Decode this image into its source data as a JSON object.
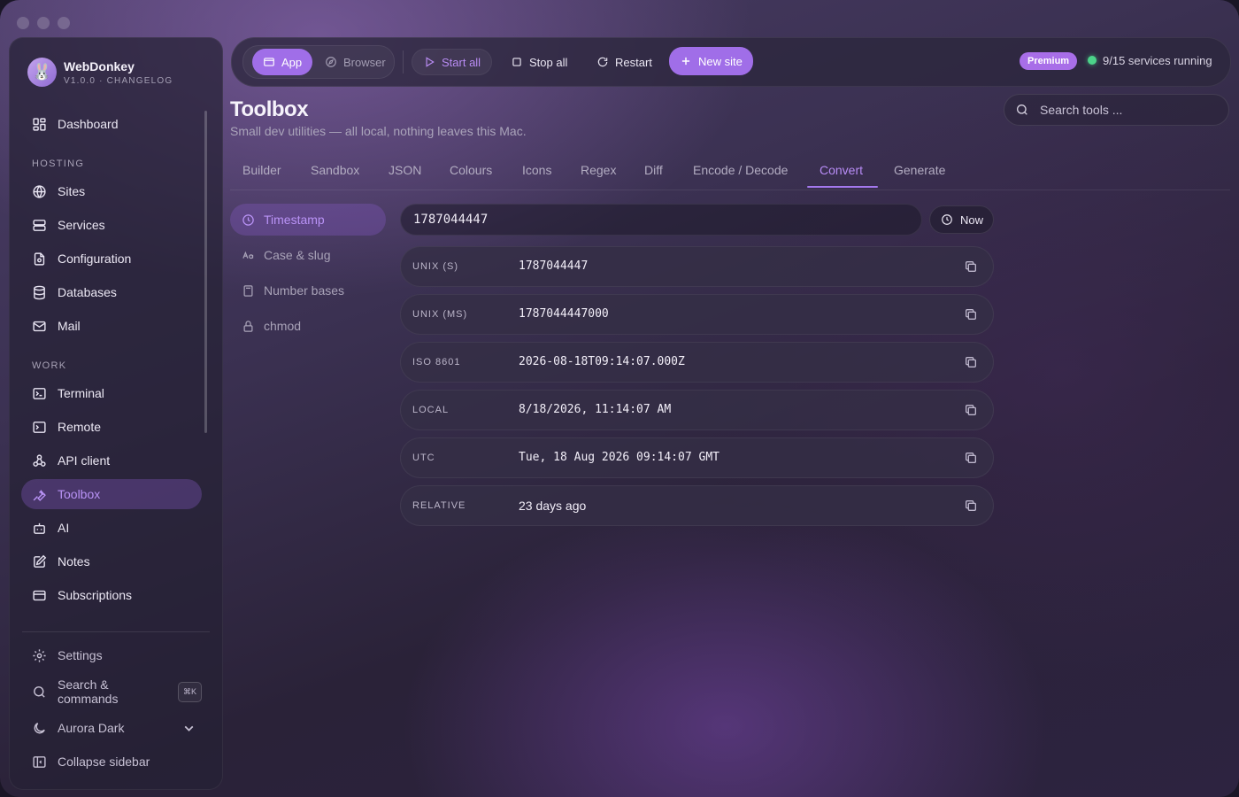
{
  "app": {
    "name": "WebDonkey",
    "version_line": "V1.0.0 · CHANGELOG"
  },
  "sidebar": {
    "top_items": [
      {
        "label": "Dashboard"
      }
    ],
    "sections": [
      {
        "title": "HOSTING",
        "items": [
          {
            "label": "Sites"
          },
          {
            "label": "Services"
          },
          {
            "label": "Configuration"
          },
          {
            "label": "Databases"
          },
          {
            "label": "Mail"
          }
        ]
      },
      {
        "title": "WORK",
        "items": [
          {
            "label": "Terminal"
          },
          {
            "label": "Remote"
          },
          {
            "label": "API client"
          },
          {
            "label": "Toolbox",
            "active": true
          },
          {
            "label": "AI"
          },
          {
            "label": "Notes"
          },
          {
            "label": "Subscriptions"
          }
        ]
      }
    ],
    "bottom": {
      "settings": "Settings",
      "search": "Search & commands",
      "search_shortcut": "⌘K",
      "theme": "Aurora Dark",
      "collapse": "Collapse sidebar"
    }
  },
  "toolbar": {
    "mode_app": "App",
    "mode_browser": "Browser",
    "start_all": "Start all",
    "stop_all": "Stop all",
    "restart": "Restart",
    "new_site": "New site",
    "premium": "Premium",
    "status": "9/15 services running",
    "status_color": "#4cd38a"
  },
  "page": {
    "title": "Toolbox",
    "subtitle": "Small dev utilities — all local, nothing leaves this Mac.",
    "search_placeholder": "Search tools ..."
  },
  "tabs": [
    "Builder",
    "Sandbox",
    "JSON",
    "Colours",
    "Icons",
    "Regex",
    "Diff",
    "Encode / Decode",
    "Convert",
    "Generate"
  ],
  "active_tab": "Convert",
  "convert_menu": [
    {
      "label": "Timestamp",
      "icon": "clock-icon",
      "active": true
    },
    {
      "label": "Case & slug",
      "icon": "text-case-icon"
    },
    {
      "label": "Number bases",
      "icon": "calculator-icon"
    },
    {
      "label": "chmod",
      "icon": "lock-icon"
    }
  ],
  "timestamp": {
    "input_value": "1787044447",
    "now_label": "Now",
    "rows": [
      {
        "label": "UNIX (S)",
        "value": "1787044447",
        "mono": true
      },
      {
        "label": "UNIX (MS)",
        "value": "1787044447000",
        "mono": true
      },
      {
        "label": "ISO 8601",
        "value": "2026-08-18T09:14:07.000Z",
        "mono": true
      },
      {
        "label": "LOCAL",
        "value": "8/18/2026, 11:14:07 AM",
        "mono": true
      },
      {
        "label": "UTC",
        "value": "Tue, 18 Aug 2026 09:14:07 GMT",
        "mono": true
      },
      {
        "label": "RELATIVE",
        "value": "23 days ago",
        "mono": false
      }
    ]
  },
  "colors": {
    "accent": "#a06ee8",
    "accent_text": "#b993f6"
  }
}
